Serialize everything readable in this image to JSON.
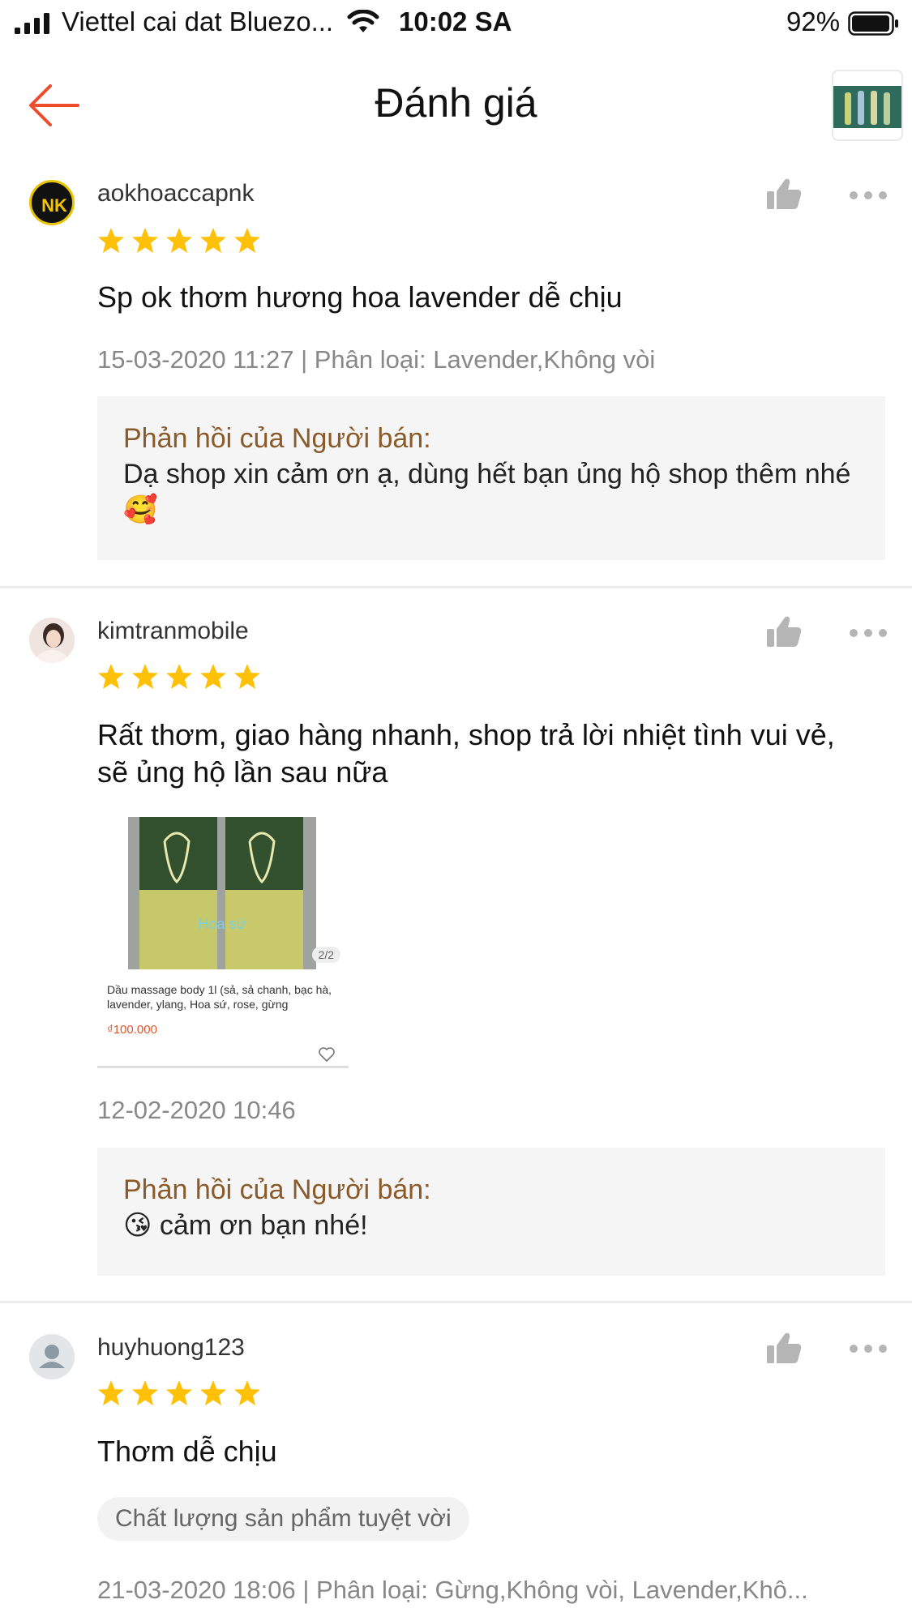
{
  "status_bar": {
    "carrier": "Viettel cai dat Bluezo...",
    "time": "10:02 SA",
    "battery_percent": "92%"
  },
  "header": {
    "title": "Đánh giá"
  },
  "colors": {
    "accent": "#ee4d2d",
    "star": "#ffc107",
    "seller_label": "#8a5a2a",
    "meta_text": "#888888"
  },
  "reviews": [
    {
      "username": "aokhoaccapnk",
      "rating": 5,
      "text": "Sp ok thơm hương hoa lavender dễ chịu",
      "meta": "15-03-2020 11:27 | Phân loại: Lavender,Không vòi",
      "seller_reply_label": "Phản hồi của Người bán:",
      "seller_reply_text": "Dạ shop xin cảm ơn ạ, dùng hết bạn ủng hộ shop thêm nhé 🥰",
      "avatar_text": "NK"
    },
    {
      "username": "kimtranmobile",
      "rating": 5,
      "text": "Rất thơm, giao hàng nhanh, shop trả lời nhiệt tình vui vẻ, sẽ ủng hộ lần sau nữa",
      "image_card": {
        "badge": "2/2",
        "watermark": "Hoa sứ",
        "title": "Dầu massage body 1l (sả, sả chanh, bạc hà, lavender, ylang, Hoa sứ, rose, gừng",
        "price": "₫100.000"
      },
      "meta": "12-02-2020 10:46",
      "seller_reply_label": "Phản hồi của Người bán:",
      "seller_reply_text": "😘 cảm ơn bạn nhé!"
    },
    {
      "username": "huyhuong123",
      "rating": 5,
      "text": "Thơm dễ chịu",
      "tag": "Chất lượng sản phẩm tuyệt vời",
      "meta": "21-03-2020 18:06 | Phân loại: Gừng,Không vòi, Lavender,Khô..."
    }
  ]
}
